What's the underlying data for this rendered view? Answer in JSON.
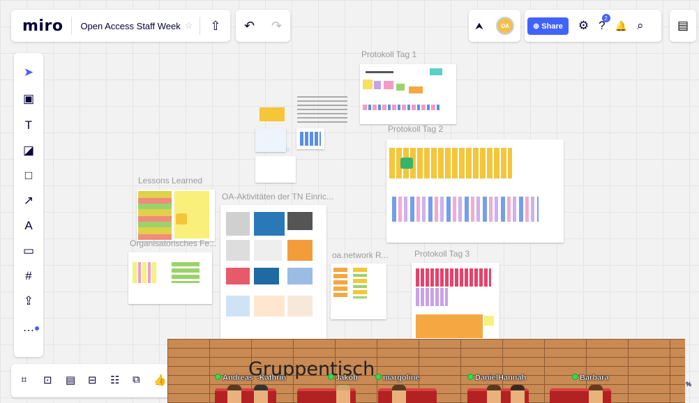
{
  "app": {
    "logo": "miro",
    "board_title": "Open Access Staff Week",
    "star": "☆",
    "upload_icon": "⇧"
  },
  "undo_redo": {
    "undo": "↶",
    "redo": "↷"
  },
  "collab": {
    "cursor_icon": "⮝",
    "avatar_initials": "OA"
  },
  "header_right": {
    "share_label": "⊕ Share",
    "settings_icon": "⚙",
    "help_icon": "?",
    "help_badge": "2",
    "bell_icon": "🔔",
    "search_icon": "⌕",
    "notes_icon": "▤"
  },
  "toolbar": {
    "tools": [
      "select",
      "templates",
      "text",
      "sticky-note",
      "shape",
      "connection-line",
      "pen",
      "comment",
      "frame",
      "upload",
      "more"
    ],
    "glyphs": [
      "➤",
      "▣",
      "T",
      "◪",
      "□",
      "↗",
      "A",
      "▭",
      "#",
      "⇪",
      "…"
    ]
  },
  "bottombar": {
    "glyphs": [
      "⌗",
      "⊡",
      "▤",
      "⊟",
      "☷",
      "⧉",
      "👍"
    ]
  },
  "frames": [
    {
      "title": "Protokoll Tag 1"
    },
    {
      "title": "Protokoll Tag 2"
    },
    {
      "title": "Lessons Learned"
    },
    {
      "title": "OA-Aktivitäten der TN Einric..."
    },
    {
      "title": "Organisatorisches Fe..."
    },
    {
      "title": "oa.network R..."
    },
    {
      "title": "Protokoll Tag 3"
    },
    {
      "title": "Socialize"
    }
  ],
  "game": {
    "title": "Gruppentisch",
    "players": [
      "Andreas",
      "Kathrin",
      "Jakob",
      "margoline",
      "Daniel",
      "Hannah",
      "Barbara"
    ]
  },
  "zoom_fragment": "%",
  "colors": {
    "accent": "#4262ff",
    "game_floor": "#c98a54",
    "sofa": "#b32222"
  }
}
